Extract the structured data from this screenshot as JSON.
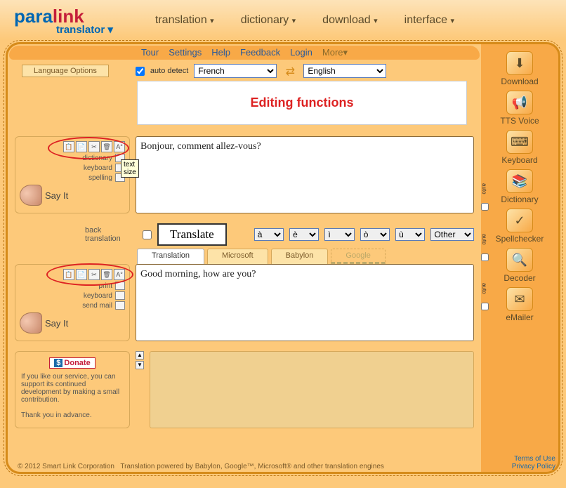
{
  "logo": {
    "part1": "para",
    "part2": "link",
    "sub": "translator"
  },
  "topnav": {
    "items": [
      "translation",
      "dictionary",
      "download",
      "interface"
    ]
  },
  "menubar": {
    "items": [
      "Tour",
      "Settings",
      "Help",
      "Feedback",
      "Login"
    ],
    "more": "More▾"
  },
  "lang": {
    "options_btn": "Language Options",
    "autodetect": "auto detect",
    "source": "French",
    "target": "English"
  },
  "annotation": "Editing functions",
  "tooltip": "text size",
  "panels": {
    "top": {
      "tools": {
        "dictionary": "dictionary",
        "keyboard": "keyboard",
        "spelling": "spelling"
      },
      "sayit": "Say It",
      "text": "Bonjour, comment allez-vous?"
    },
    "mid": {
      "back_translation": "back translation",
      "translate_btn": "Translate",
      "accents": [
        "à",
        "è",
        "ì",
        "ò",
        "ù"
      ],
      "other": "Other"
    },
    "tabs": [
      "Translation",
      "Microsoft",
      "Babylon",
      "Google"
    ],
    "bottom": {
      "tools": {
        "print": "print",
        "keyboard": "keyboard",
        "sendmail": "send mail"
      },
      "sayit": "Say It",
      "text": "Good morning, how are you?"
    }
  },
  "donate": {
    "btn": "Donate",
    "body": "If you like our service, you can support its continued development by making a small contribution.",
    "thanks": "Thank you in advance."
  },
  "sidebar": {
    "items": [
      {
        "label": "Download",
        "icon": "⬇"
      },
      {
        "label": "TTS Voice",
        "icon": "📢"
      },
      {
        "label": "Keyboard",
        "icon": "⌨"
      },
      {
        "label": "Dictionary",
        "icon": "📚"
      },
      {
        "label": "Spellchecker",
        "icon": "✓"
      },
      {
        "label": "Decoder",
        "icon": "🔍"
      },
      {
        "label": "eMailer",
        "icon": "✉"
      }
    ],
    "auto": "auto"
  },
  "footer": {
    "copyright": "© 2012 Smart Link Corporation",
    "powered": "Translation powered by Babylon, Google™, Microsoft® and other translation engines",
    "terms": "Terms of Use",
    "privacy": "Privacy Policy"
  }
}
